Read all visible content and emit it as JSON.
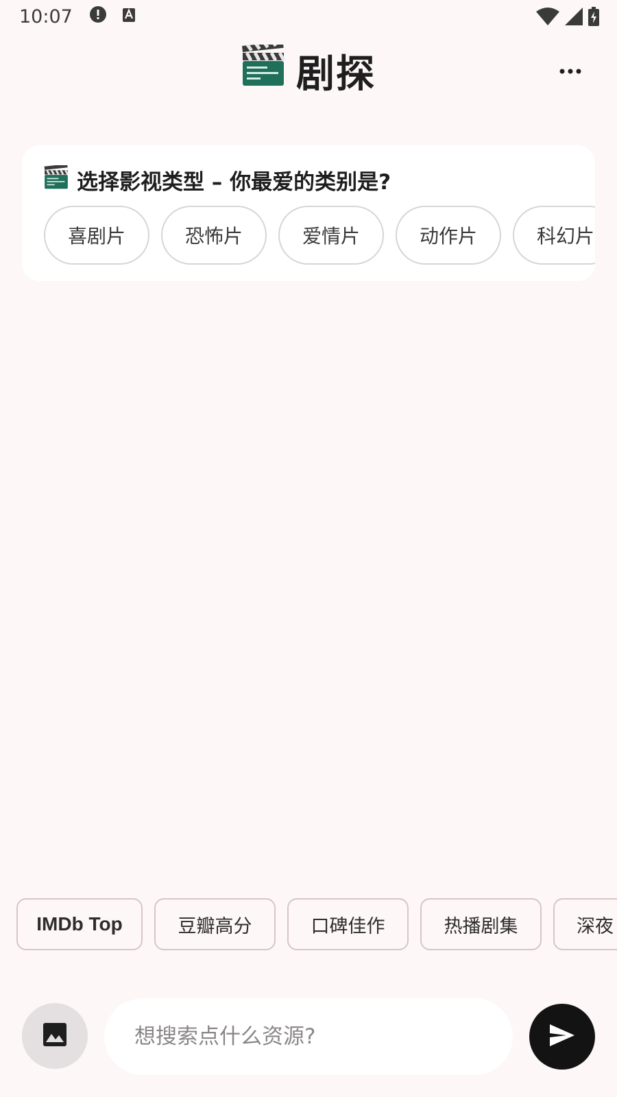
{
  "status_bar": {
    "time": "10:07",
    "left_icons": [
      "alert-icon",
      "keyboard-a-icon"
    ],
    "right_icons": [
      "wifi-icon",
      "cellular-signal-icon",
      "battery-charging-icon"
    ]
  },
  "header": {
    "icon": "clapper-board-icon",
    "title": "剧探",
    "menu_icon": "more-horizontal-icon"
  },
  "genre_card": {
    "icon": "clapper-board-icon",
    "question": "选择影视类型 – 你最爱的类别是?",
    "chips": [
      "喜剧片",
      "恐怖片",
      "爱情片",
      "动作片",
      "科幻片"
    ]
  },
  "quick_chips": [
    "IMDb Top",
    "豆瓣高分",
    "口碑佳作",
    "热播剧集",
    "深夜"
  ],
  "input_bar": {
    "image_icon": "image-icon",
    "placeholder": "想搜索点什么资源?",
    "value": "",
    "send_icon": "send-icon"
  },
  "colors": {
    "background": "#fdf7f7",
    "card": "#ffffff",
    "send_button": "#141314",
    "chip_border": "#d8c5c8"
  }
}
